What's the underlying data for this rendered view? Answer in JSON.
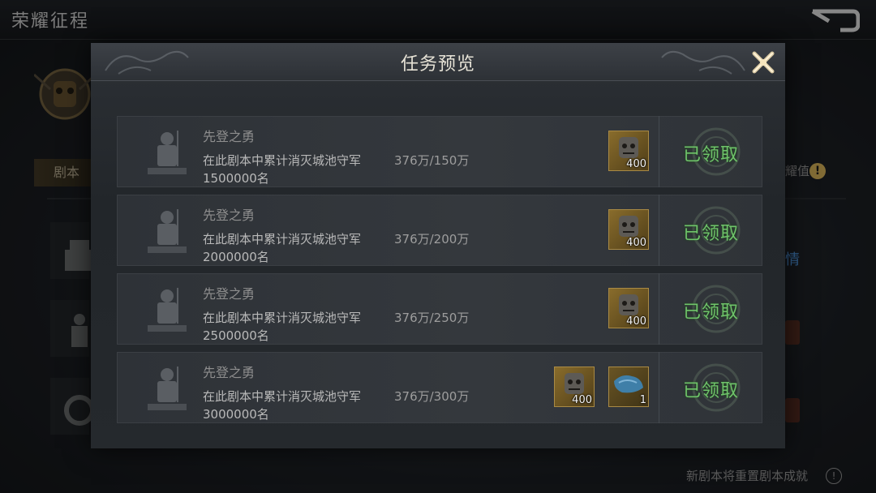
{
  "page": {
    "title": "荣耀征程",
    "tab_label": "剧本",
    "right_label": "耀值",
    "right_link": "情",
    "footer_note": "新剧本将重置剧本成就"
  },
  "modal": {
    "title": "任务预览",
    "tasks": [
      {
        "name": "先登之勇",
        "desc": "在此剧本中累计消灭城池守军",
        "progress": "376万/150万",
        "target": "1500000名",
        "rewards": [
          {
            "icon": "bronze-mask-icon",
            "count": "400"
          }
        ],
        "status": "已领取"
      },
      {
        "name": "先登之勇",
        "desc": "在此剧本中累计消灭城池守军",
        "progress": "376万/200万",
        "target": "2000000名",
        "rewards": [
          {
            "icon": "bronze-mask-icon",
            "count": "400"
          }
        ],
        "status": "已领取"
      },
      {
        "name": "先登之勇",
        "desc": "在此剧本中累计消灭城池守军",
        "progress": "376万/250万",
        "target": "2500000名",
        "rewards": [
          {
            "icon": "bronze-mask-icon",
            "count": "400"
          }
        ],
        "status": "已领取"
      },
      {
        "name": "先登之勇",
        "desc": "在此剧本中累计消灭城池守军",
        "progress": "376万/300万",
        "target": "3000000名",
        "rewards": [
          {
            "icon": "bronze-mask-icon",
            "count": "400"
          },
          {
            "icon": "blue-cloth-icon",
            "count": "1"
          }
        ],
        "status": "已领取"
      }
    ]
  },
  "colors": {
    "claimed": "#6fc46a",
    "gold_frame": "#a98a45",
    "link_blue": "#4a8fd6"
  }
}
